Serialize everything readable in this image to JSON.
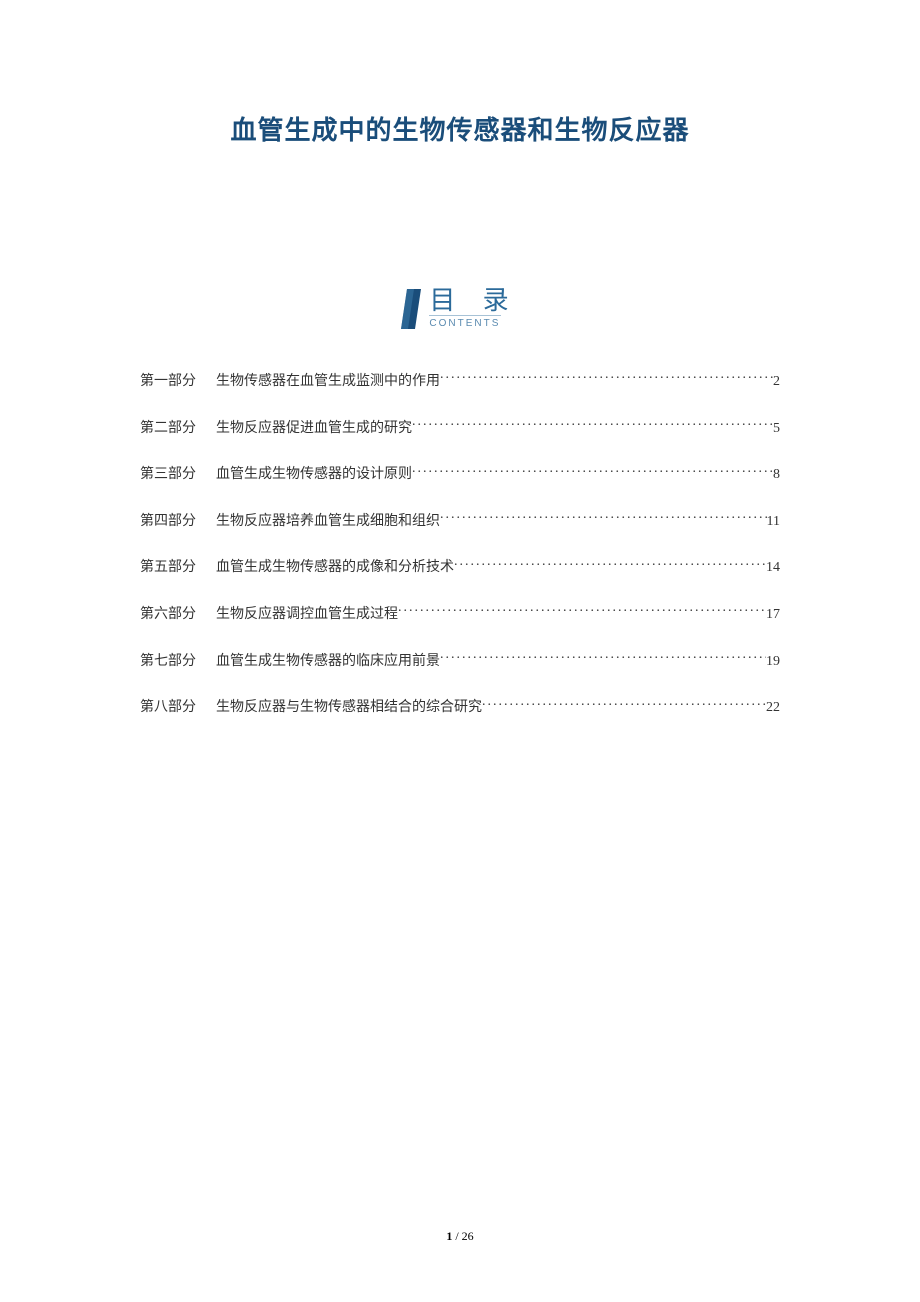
{
  "title": "血管生成中的生物传感器和生物反应器",
  "toc_header": {
    "main": "目 录",
    "sub": "CONTENTS"
  },
  "toc": [
    {
      "part": "第一部分",
      "text": "生物传感器在血管生成监测中的作用",
      "page": "2"
    },
    {
      "part": "第二部分",
      "text": "生物反应器促进血管生成的研究",
      "page": "5"
    },
    {
      "part": "第三部分",
      "text": "血管生成生物传感器的设计原则",
      "page": "8"
    },
    {
      "part": "第四部分",
      "text": "生物反应器培养血管生成细胞和组织",
      "page": "11"
    },
    {
      "part": "第五部分",
      "text": "血管生成生物传感器的成像和分析技术",
      "page": "14"
    },
    {
      "part": "第六部分",
      "text": "生物反应器调控血管生成过程",
      "page": "17"
    },
    {
      "part": "第七部分",
      "text": "血管生成生物传感器的临床应用前景",
      "page": "19"
    },
    {
      "part": "第八部分",
      "text": "生物反应器与生物传感器相结合的综合研究",
      "page": "22"
    }
  ],
  "footer": {
    "current": "1",
    "separator": " / ",
    "total": "26"
  }
}
